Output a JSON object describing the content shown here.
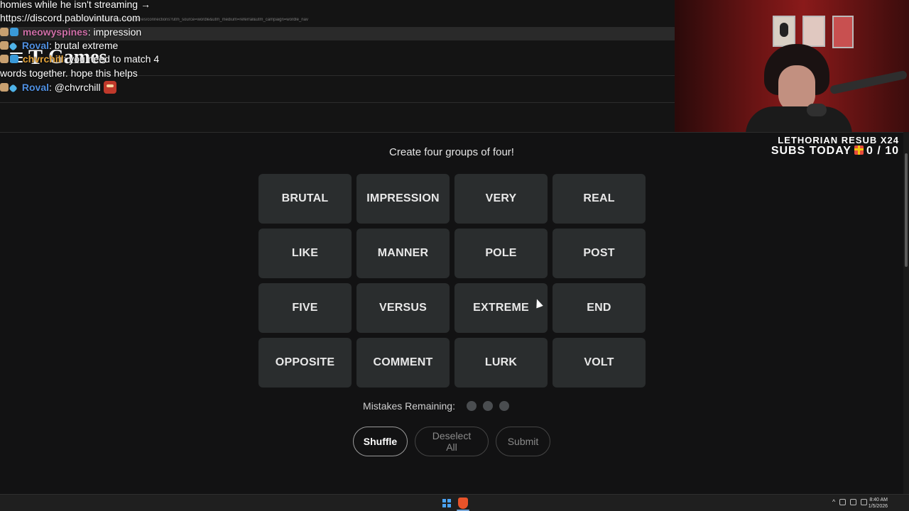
{
  "browser": {
    "url": "https://www.nytimes.com/games/connections?utm_source=wordle&utm_medium=referral&utm_campaign=wordle_nav",
    "logo_t": "T",
    "logo_games": "Games"
  },
  "chat": {
    "lines": [
      {
        "text": "homies while he isn't streaming →"
      },
      {
        "text": "https://discord.pablovintura.com"
      },
      {
        "user": "meowyspines",
        "user_color": "#d06fa8",
        "message": ": impression"
      },
      {
        "user": "Roval",
        "user_color": "#4f8fe0",
        "message": ": brutal extreme"
      },
      {
        "user": "chvrchill",
        "user_color": "#e5a43a",
        "message": ": you need to match 4"
      },
      {
        "text": "words together. hope this helps"
      },
      {
        "user": "Roval",
        "user_color": "#4f8fe0",
        "message": ": @chvrchill"
      }
    ]
  },
  "alert": {
    "line1": "LETHORIAN RESUB X24",
    "line2_prefix": "SUBS TODAY",
    "line2_count": "0 / 10"
  },
  "game": {
    "instructions": "Create four groups of four!",
    "words": [
      "BRUTAL",
      "IMPRESSION",
      "VERY",
      "REAL",
      "LIKE",
      "MANNER",
      "POLE",
      "POST",
      "FIVE",
      "VERSUS",
      "EXTREME",
      "END",
      "OPPOSITE",
      "COMMENT",
      "LURK",
      "VOLT"
    ],
    "mistakes_label": "Mistakes Remaining:",
    "mistakes_remaining": 3,
    "buttons": {
      "shuffle": "Shuffle",
      "deselect": "Deselect All",
      "submit": "Submit"
    }
  },
  "taskbar": {
    "time": "8:40 AM",
    "date": "1/5/2026"
  },
  "colors": {
    "background": "#121213",
    "tile": "#2a2d2e",
    "dot": "#4a4d50"
  }
}
